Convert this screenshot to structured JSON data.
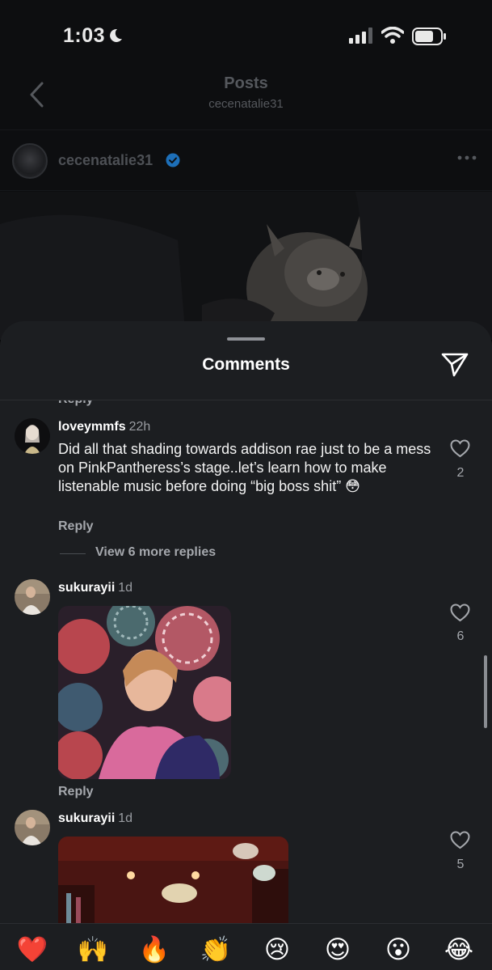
{
  "status_bar": {
    "time": "1:03"
  },
  "nav": {
    "title": "Posts",
    "subtitle": "cecenatalie31"
  },
  "post": {
    "username": "cecenatalie31"
  },
  "sheet": {
    "title": "Comments",
    "cut_reply_label": "Reply"
  },
  "comments": [
    {
      "username": "loveymmfs",
      "time": "22h",
      "text": "Did all that shading towards addison rae just to be a mess on PinkPantheress’s stage..let’s learn how to make listenable music before doing “big boss shit” 😳",
      "reply_label": "Reply",
      "view_replies": "View 6 more replies",
      "likes": "2"
    },
    {
      "username": "sukurayii",
      "time": "1d",
      "reply_label": "Reply",
      "likes": "6"
    },
    {
      "username": "sukurayii",
      "time": "1d",
      "likes": "5"
    }
  ],
  "emoji_bar": [
    "❤️",
    "🙌",
    "🔥",
    "👏",
    "😢",
    "😍",
    "😮",
    "😂"
  ],
  "colors": {
    "sheet_bg": "#1c1e21",
    "secondary_text": "#a5a8ad",
    "verified_blue": "#1d6fb8"
  }
}
